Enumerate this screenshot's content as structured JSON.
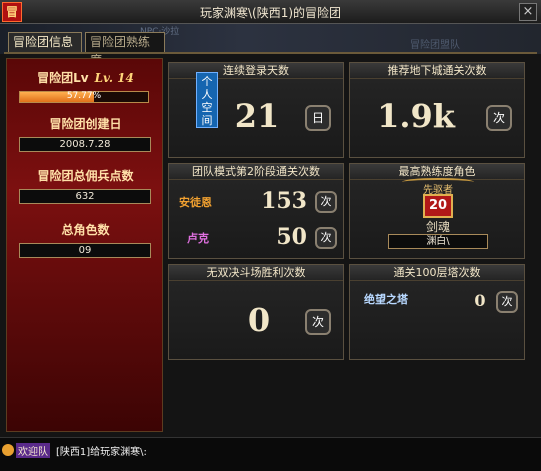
{
  "window": {
    "title": "玩家渊寒\\(陕西1)的冒险团",
    "logo_glyph": "冒",
    "close_glyph": "×"
  },
  "background": {
    "npc_tag": "NPC·沙拉",
    "faint_text": "冒险团盟队"
  },
  "tabs": [
    {
      "label": "冒险团信息",
      "active": true
    },
    {
      "label": "冒险团熟练度",
      "active": false
    }
  ],
  "left_panel": {
    "level_label": "冒险团Lv",
    "level_value": "Lv. 14",
    "progress_text": "57.77%",
    "progress_fraction": 0.5777,
    "created_label": "冒险团创建日",
    "created_value": "2008.7.28",
    "mercenary_label": "冒险团总佣兵点数",
    "mercenary_value": "632",
    "characters_label": "总角色数",
    "characters_value": "09"
  },
  "cards": {
    "login": {
      "title": "连续登录天数",
      "tag": "个人空间",
      "value": "21",
      "unit": "日"
    },
    "dungeon": {
      "title": "推荐地下城通关次数",
      "value": "1.9k",
      "unit": "次"
    },
    "team": {
      "title": "团队模式第2阶段通关次数",
      "rows": [
        {
          "name": "安徒恩",
          "value": "153",
          "unit": "次",
          "color": "#f0a030"
        },
        {
          "name": "卢克",
          "value": "50",
          "unit": "次",
          "color": "#e070e0"
        }
      ]
    },
    "mastery": {
      "title": "最高熟练度角色",
      "rank_label": "先驱者",
      "rank_value": "20",
      "job": "剑魂",
      "character": "渊白\\"
    },
    "pvp": {
      "title": "无双决斗场胜利次数",
      "value": "0",
      "unit": "次"
    },
    "tower": {
      "title": "通关100层塔次数",
      "name": "绝望之塔",
      "value": "0",
      "unit": "次"
    }
  },
  "chat": {
    "channel": "欢迎队",
    "message": "[陕西1]给玩家渊寒\\:"
  }
}
